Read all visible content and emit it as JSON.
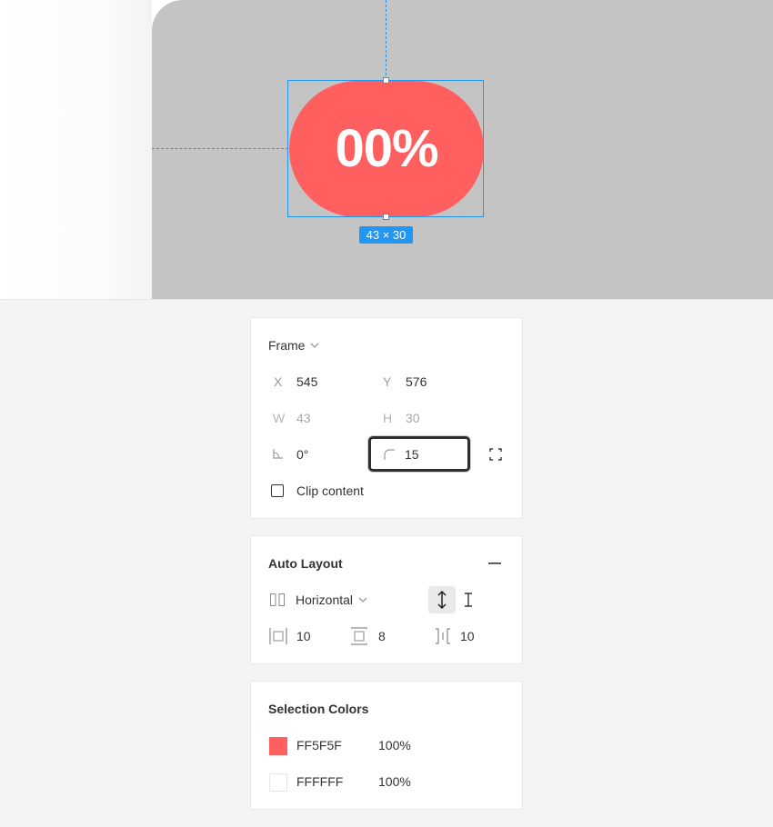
{
  "canvas": {
    "element_text": "00%",
    "element_color": "#FF5F5F",
    "size_badge": "43 × 30",
    "canvas_bg": "#C4C4C4",
    "selection_color": "#2196F3"
  },
  "frame_panel": {
    "title": "Frame",
    "x_label": "X",
    "x_value": "545",
    "y_label": "Y",
    "y_value": "576",
    "w_label": "W",
    "w_value": "43",
    "h_label": "H",
    "h_value": "30",
    "rotation_value": "0°",
    "corner_radius_value": "15",
    "clip_content_label": "Clip content",
    "clip_content_checked": false
  },
  "auto_layout_panel": {
    "title": "Auto Layout",
    "direction": "Horizontal",
    "horizontal_padding": "10",
    "vertical_padding": "8",
    "item_spacing": "10"
  },
  "selection_colors_panel": {
    "title": "Selection Colors",
    "colors": [
      {
        "hex": "FF5F5F",
        "opacity": "100%",
        "swatch": "#FF5F5F"
      },
      {
        "hex": "FFFFFF",
        "opacity": "100%",
        "swatch": "#FFFFFF"
      }
    ]
  }
}
